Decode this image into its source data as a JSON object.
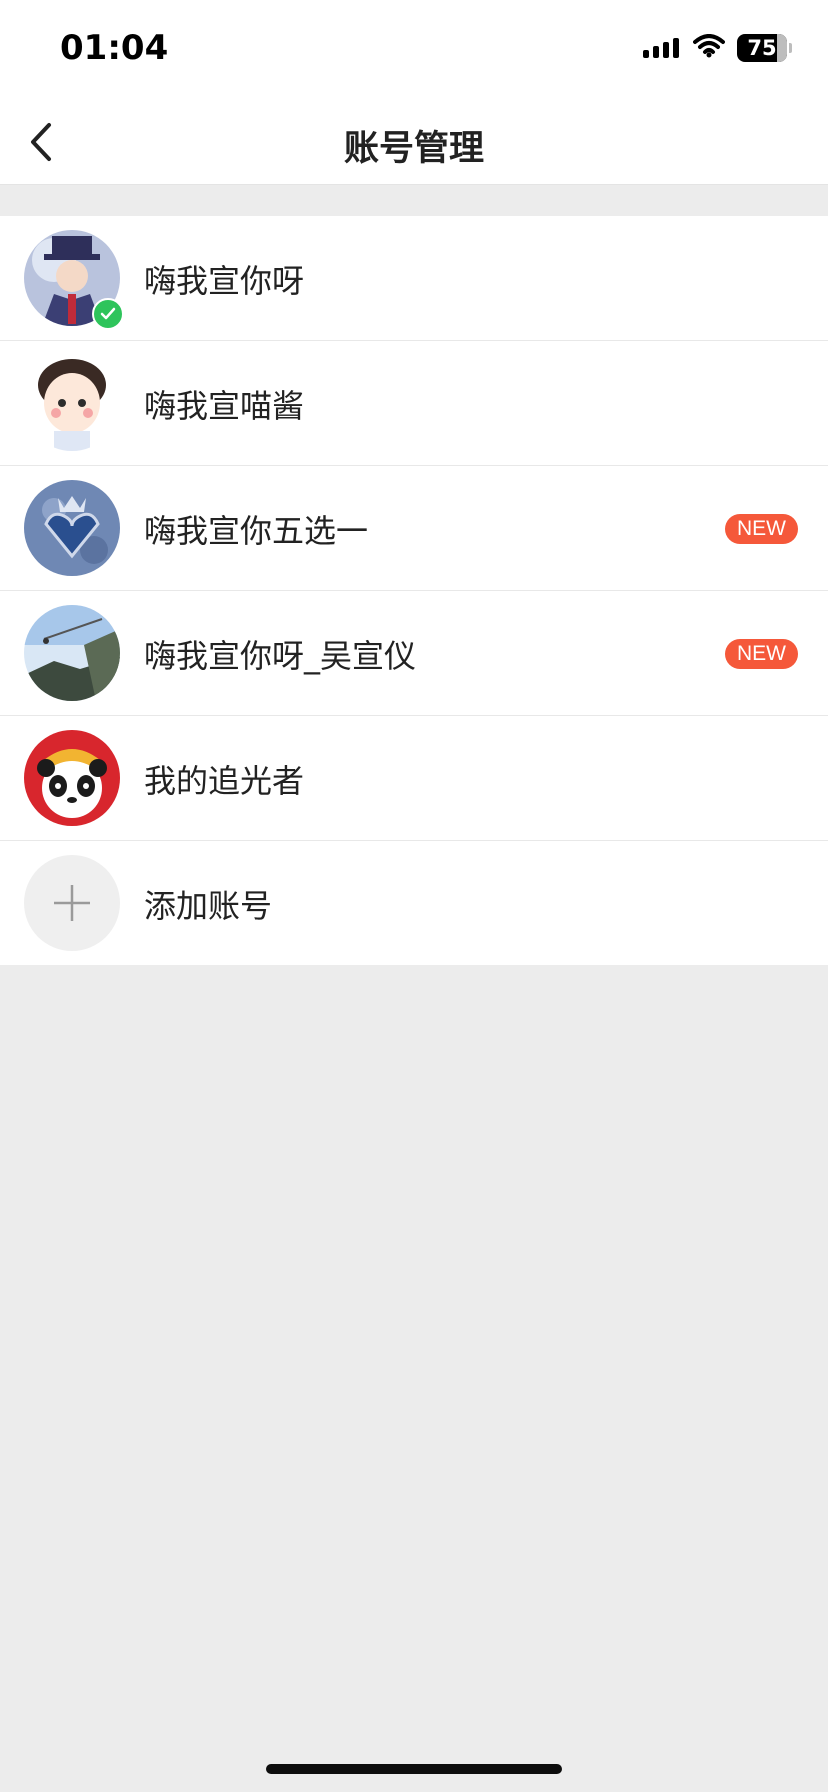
{
  "status_bar": {
    "time": "01:04",
    "battery": "75"
  },
  "nav": {
    "title": "账号管理",
    "back_icon": "chevron-left-icon"
  },
  "accounts": [
    {
      "name": "嗨我宣你呀",
      "active": true,
      "new": false
    },
    {
      "name": "嗨我宣喵酱",
      "active": false,
      "new": false
    },
    {
      "name": "嗨我宣你五选一",
      "active": false,
      "new": true,
      "badge": "NEW"
    },
    {
      "name": "嗨我宣你呀_吴宣仪",
      "active": false,
      "new": true,
      "badge": "NEW"
    },
    {
      "name": "我的追光者",
      "active": false,
      "new": false
    }
  ],
  "add_account": {
    "label": "添加账号",
    "icon": "plus-icon"
  },
  "colors": {
    "accent_new": "#f5583a",
    "active_check": "#2ec45b",
    "background": "#ececec"
  }
}
